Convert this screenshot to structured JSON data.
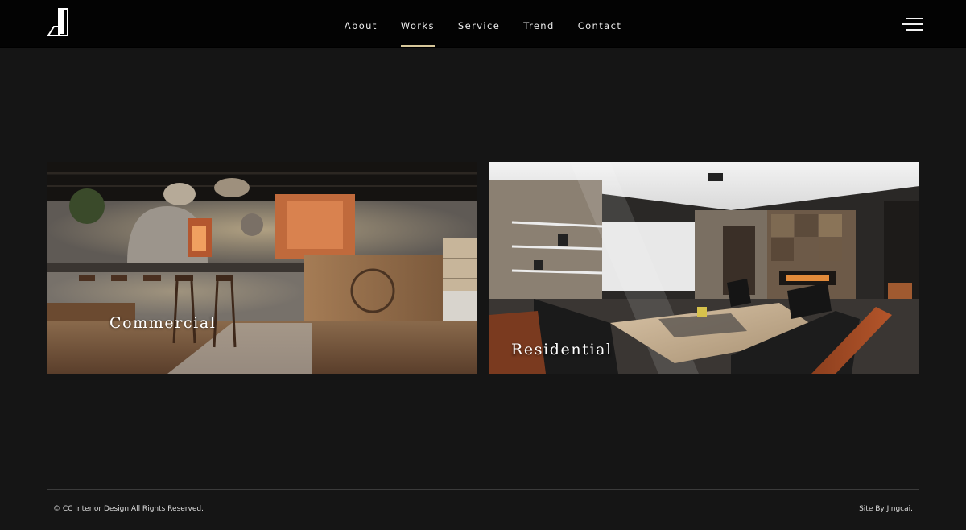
{
  "nav": {
    "items": [
      {
        "label": "About"
      },
      {
        "label": "Works",
        "active": true
      },
      {
        "label": "Service"
      },
      {
        "label": "Trend"
      },
      {
        "label": "Contact"
      }
    ],
    "active_color": "#d7c79a"
  },
  "header": {
    "logo_icon": "cc-logo-icon",
    "menu_icon": "hamburger-menu-icon"
  },
  "works": {
    "categories": [
      {
        "label": "Commercial",
        "image": "restaurant-interior-photo"
      },
      {
        "label": "Residential",
        "image": "living-room-interior-photo"
      }
    ]
  },
  "footer": {
    "copyright": "© CC Interior Design All Rights Reserved.",
    "credit": "Site By Jingcai."
  }
}
